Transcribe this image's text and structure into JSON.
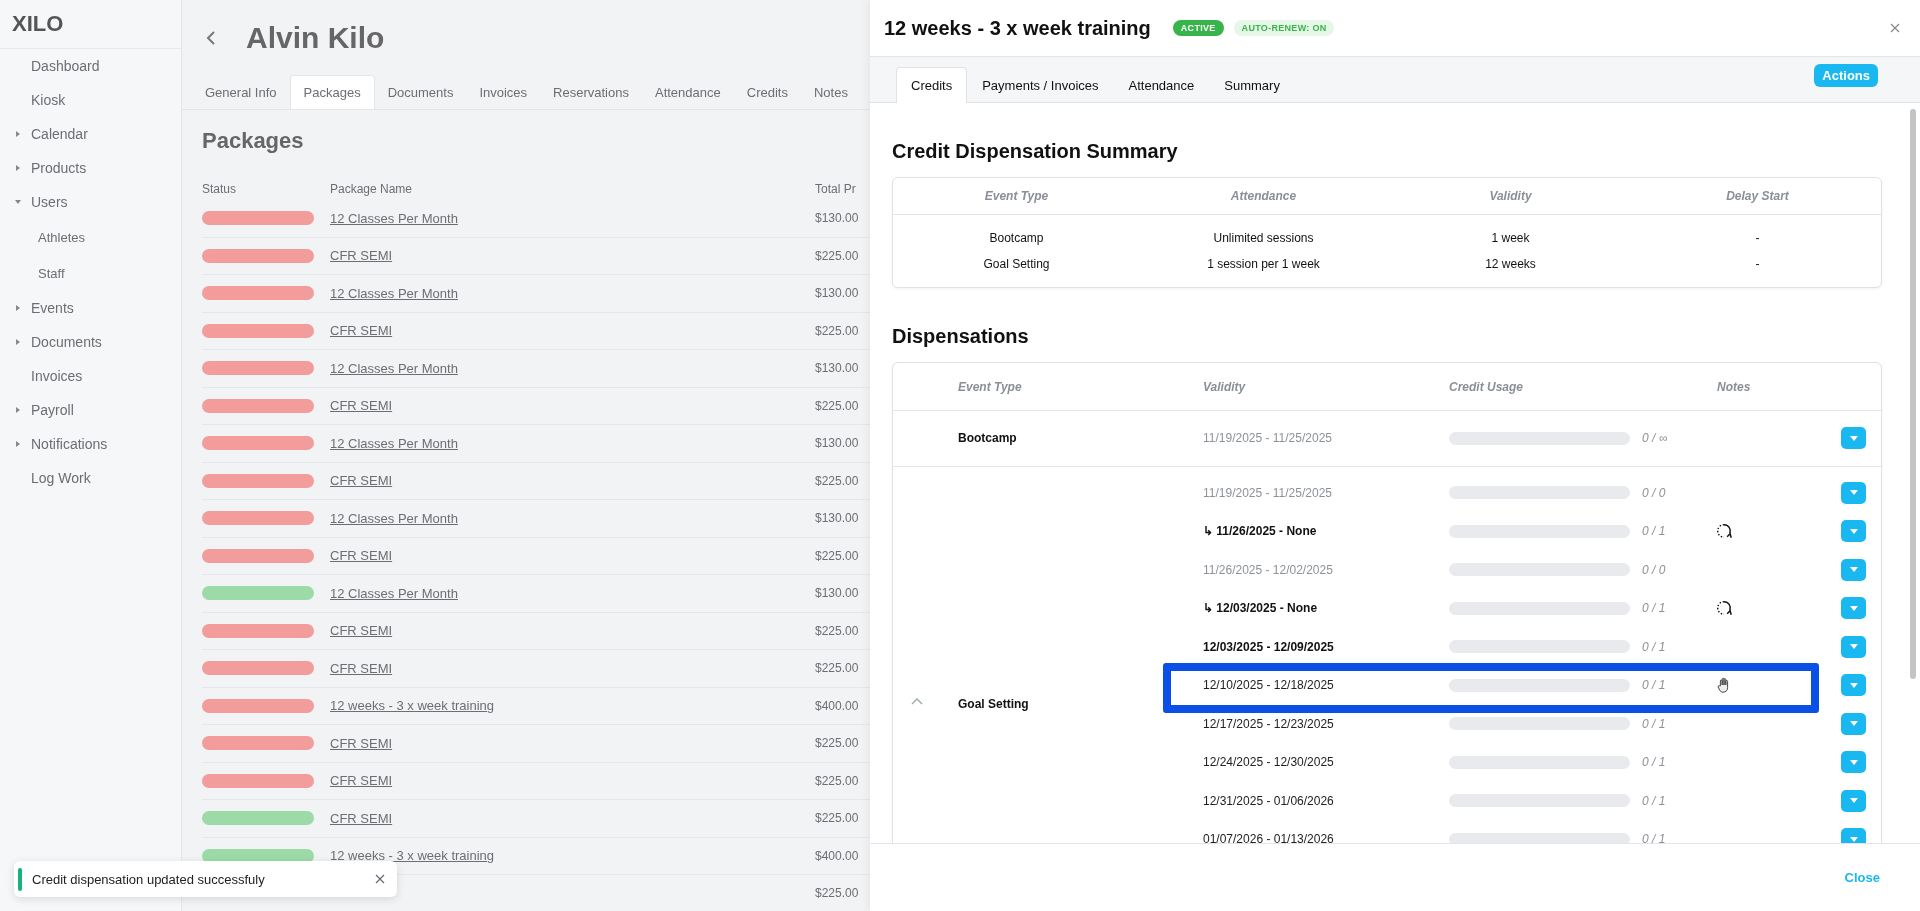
{
  "background": {
    "logo": "XILO",
    "sidebar": {
      "items": [
        {
          "label": "Dashboard",
          "expandable": false
        },
        {
          "label": "Kiosk",
          "expandable": false
        },
        {
          "label": "Calendar",
          "expandable": true,
          "expanded": false
        },
        {
          "label": "Products",
          "expandable": true,
          "expanded": false
        },
        {
          "label": "Users",
          "expandable": true,
          "expanded": true,
          "children": [
            {
              "label": "Athletes"
            },
            {
              "label": "Staff"
            }
          ]
        },
        {
          "label": "Events",
          "expandable": true,
          "expanded": false
        },
        {
          "label": "Documents",
          "expandable": true,
          "expanded": false
        },
        {
          "label": "Invoices",
          "expandable": false
        },
        {
          "label": "Payroll",
          "expandable": true,
          "expanded": false
        },
        {
          "label": "Notifications",
          "expandable": true,
          "expanded": false
        },
        {
          "label": "Log Work",
          "expandable": false
        }
      ]
    },
    "page_title": "Alvin Kilo",
    "tabs": [
      {
        "label": "General Info",
        "selected": false
      },
      {
        "label": "Packages",
        "selected": true
      },
      {
        "label": "Documents",
        "selected": false
      },
      {
        "label": "Invoices",
        "selected": false
      },
      {
        "label": "Reservations",
        "selected": false
      },
      {
        "label": "Attendance",
        "selected": false
      },
      {
        "label": "Credits",
        "selected": false
      },
      {
        "label": "Notes",
        "selected": false
      }
    ],
    "section_title": "Packages",
    "table": {
      "columns": [
        "Status",
        "Package Name",
        "Total Pr"
      ],
      "rows": [
        {
          "color": "#f29c9c",
          "name": "12 Classes Per Month",
          "price": "$130.00"
        },
        {
          "color": "#f29c9c",
          "name": "CFR SEMI",
          "price": "$225.00"
        },
        {
          "color": "#f29c9c",
          "name": "12 Classes Per Month",
          "price": "$130.00"
        },
        {
          "color": "#f29c9c",
          "name": "CFR SEMI",
          "price": "$225.00"
        },
        {
          "color": "#f29c9c",
          "name": "12 Classes Per Month",
          "price": "$130.00"
        },
        {
          "color": "#f29c9c",
          "name": "CFR SEMI",
          "price": "$225.00"
        },
        {
          "color": "#f29c9c",
          "name": "12 Classes Per Month",
          "price": "$130.00"
        },
        {
          "color": "#f29c9c",
          "name": "CFR SEMI",
          "price": "$225.00"
        },
        {
          "color": "#f29c9c",
          "name": "12 Classes Per Month",
          "price": "$130.00"
        },
        {
          "color": "#f29c9c",
          "name": "CFR SEMI",
          "price": "$225.00"
        },
        {
          "color": "#9cdba8",
          "name": "12 Classes Per Month",
          "price": "$130.00"
        },
        {
          "color": "#f29c9c",
          "name": "CFR SEMI",
          "price": "$225.00"
        },
        {
          "color": "#f29c9c",
          "name": "CFR SEMI",
          "price": "$225.00"
        },
        {
          "color": "#f29c9c",
          "name": "12 weeks - 3 x week training",
          "price": "$400.00"
        },
        {
          "color": "#f29c9c",
          "name": "CFR SEMI",
          "price": "$225.00"
        },
        {
          "color": "#f29c9c",
          "name": "CFR SEMI",
          "price": "$225.00"
        },
        {
          "color": "#9cdba8",
          "name": "CFR SEMI",
          "price": "$225.00"
        },
        {
          "color": "#9cdba8",
          "name": "12 weeks - 3 x week training",
          "price": "$400.00"
        },
        {
          "price": "$225.00"
        }
      ]
    }
  },
  "toast": {
    "message": "Credit dispensation updated successfuly"
  },
  "drawer": {
    "title": "12 weeks - 3 x week training",
    "badges": [
      {
        "label": "ACTIVE",
        "kind": "solid"
      },
      {
        "label": "AUTO-RENEW: ON",
        "kind": "soft"
      }
    ],
    "tabs": [
      {
        "label": "Credits",
        "selected": true
      },
      {
        "label": "Payments / Invoices",
        "selected": false
      },
      {
        "label": "Attendance",
        "selected": false
      },
      {
        "label": "Summary",
        "selected": false
      }
    ],
    "actions_button": "Actions",
    "summary": {
      "title": "Credit Dispensation Summary",
      "columns": [
        "Event Type",
        "Attendance",
        "Validity",
        "Delay Start"
      ],
      "rows": [
        [
          "Bootcamp",
          "Unlimited sessions",
          "1 week",
          "-"
        ],
        [
          "Goal Setting",
          "1 session per 1 week",
          "12 weeks",
          "-"
        ]
      ]
    },
    "dispensations": {
      "title": "Dispensations",
      "columns": [
        "Event Type",
        "Validity",
        "Credit Usage",
        "Notes"
      ],
      "groups": [
        {
          "event_type": "Bootcamp",
          "collapsible": false,
          "rows": [
            {
              "validity": "11/19/2025 - 11/25/2025",
              "kind": "past",
              "level": 0,
              "usage": "0 / ∞",
              "delayed": false,
              "paused": false
            }
          ]
        },
        {
          "event_type": "Goal Setting",
          "collapsible": true,
          "expanded": true,
          "rows": [
            {
              "validity": "11/19/2025 - 11/25/2025",
              "kind": "past",
              "level": 0,
              "usage": "0 / 0",
              "delayed": false,
              "paused": false
            },
            {
              "validity": "↳ 11/26/2025 - None",
              "kind": "active",
              "level": 0,
              "usage": "0 / 1",
              "delayed": true,
              "paused": false
            },
            {
              "validity": "11/26/2025 - 12/02/2025",
              "kind": "past",
              "level": 0,
              "usage": "0 / 0",
              "delayed": false,
              "paused": false
            },
            {
              "validity": "↳ 12/03/2025 - None",
              "kind": "active",
              "level": 0,
              "usage": "0 / 1",
              "delayed": true,
              "paused": false
            },
            {
              "validity": "12/03/2025 - 12/09/2025",
              "kind": "active",
              "level": 0,
              "usage": "0 / 1",
              "delayed": false,
              "paused": false
            },
            {
              "validity": "12/10/2025 - 12/18/2025",
              "kind": "upcoming",
              "level": 0,
              "usage": "0 / 1",
              "delayed": false,
              "paused": true,
              "highlighted": true
            },
            {
              "validity": "12/17/2025 - 12/23/2025",
              "kind": "upcoming",
              "level": 0,
              "usage": "0 / 1",
              "delayed": false,
              "paused": false
            },
            {
              "validity": "12/24/2025 - 12/30/2025",
              "kind": "upcoming",
              "level": 0,
              "usage": "0 / 1",
              "delayed": false,
              "paused": false
            },
            {
              "validity": "12/31/2025 - 01/06/2026",
              "kind": "upcoming",
              "level": 0,
              "usage": "0 / 1",
              "delayed": false,
              "paused": false
            },
            {
              "validity": "01/07/2026 - 01/13/2026",
              "kind": "upcoming",
              "level": 0,
              "usage": "0 / 1",
              "delayed": false,
              "paused": false
            }
          ]
        }
      ]
    },
    "footer_button": "Close"
  }
}
